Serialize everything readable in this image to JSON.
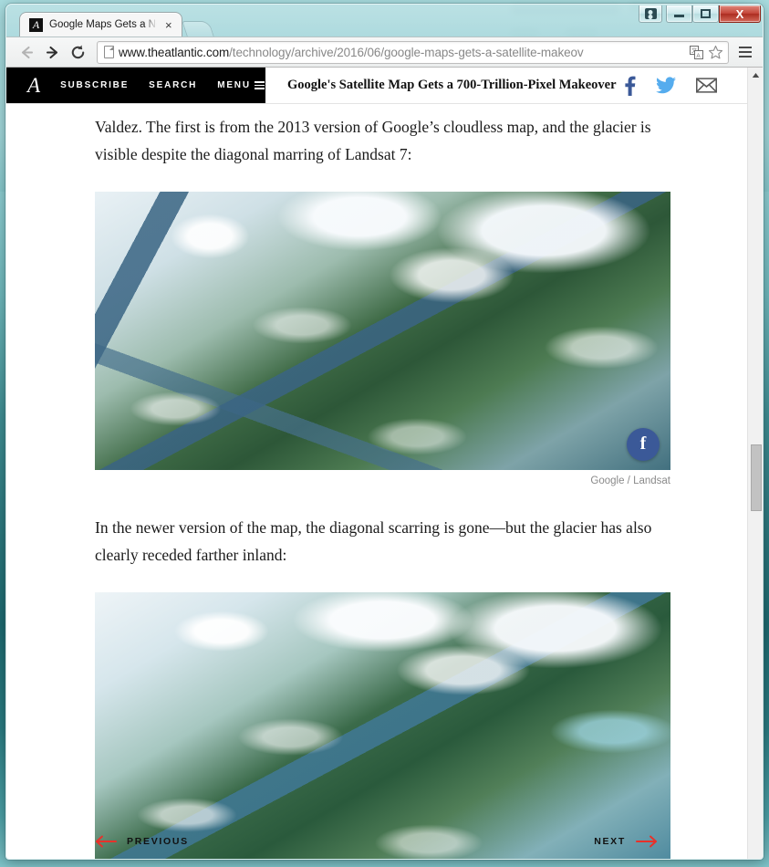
{
  "browser": {
    "tab": {
      "title": "Google Maps Gets a New",
      "favicon": "A",
      "close_label": "×"
    },
    "new_tab_tooltip": "New tab",
    "controls": {
      "user_label": "user-icon",
      "minimize_label": "Minimize",
      "maximize_label": "Maximize",
      "close_label": "X"
    },
    "nav": {
      "back_label": "Back",
      "forward_label": "Forward",
      "reload_label": "Reload"
    },
    "address": {
      "domain": "www.theatlantic.com",
      "path": "/technology/archive/2016/06/google-maps-gets-a-satellite-makeov",
      "translate_label": "Translate this page",
      "bookmark_label": "Bookmark this page"
    },
    "menu_label": "Customize and control"
  },
  "site": {
    "brand": "A",
    "nav_items": [
      {
        "label": "SUBSCRIBE"
      },
      {
        "label": "SEARCH"
      },
      {
        "label": "MENU"
      }
    ],
    "headline": "Google's Satellite Map Gets a 700-Trillion-Pixel Makeover",
    "socials": [
      {
        "name": "facebook-icon",
        "glyph": "f",
        "color": "#3b5998"
      },
      {
        "name": "twitter-icon",
        "glyph": "🐦",
        "color": "#55acee"
      },
      {
        "name": "email-icon",
        "glyph": "✉",
        "color": "#595959"
      }
    ]
  },
  "article": {
    "paragraph_1": "Valdez. The first is from the 2013 version of Google’s cloudless map, and the glacier is visible despite the diagonal marring of Landsat 7:",
    "paragraph_2": "In the newer version of the map, the diagonal scarring is gone—but the glacier has also clearly receded farther inland:",
    "figure_1": {
      "alt": "Satellite view of Columbia Glacier near Valdez, Alaska, 2013 version with diagonal Landsat 7 scarring",
      "caption": "Google / Landsat",
      "share_label": "f"
    },
    "figure_2": {
      "alt": "Satellite view of Columbia Glacier near Valdez, Alaska, newer version without diagonal scarring",
      "caption": ""
    }
  },
  "pager": {
    "previous_label": "PREVIOUS",
    "next_label": "NEXT"
  },
  "scrollbar": {
    "up_label": "Scroll up",
    "thumb_label": "Vertical scrollbar thumb"
  },
  "colors": {
    "brand_black": "#000000",
    "accent_red": "#e8312a",
    "facebook_blue": "#3b5998",
    "twitter_blue": "#55acee",
    "email_gray": "#595959",
    "caption_gray": "#8a8a8a",
    "desktop_teal": "#3f8f94"
  }
}
